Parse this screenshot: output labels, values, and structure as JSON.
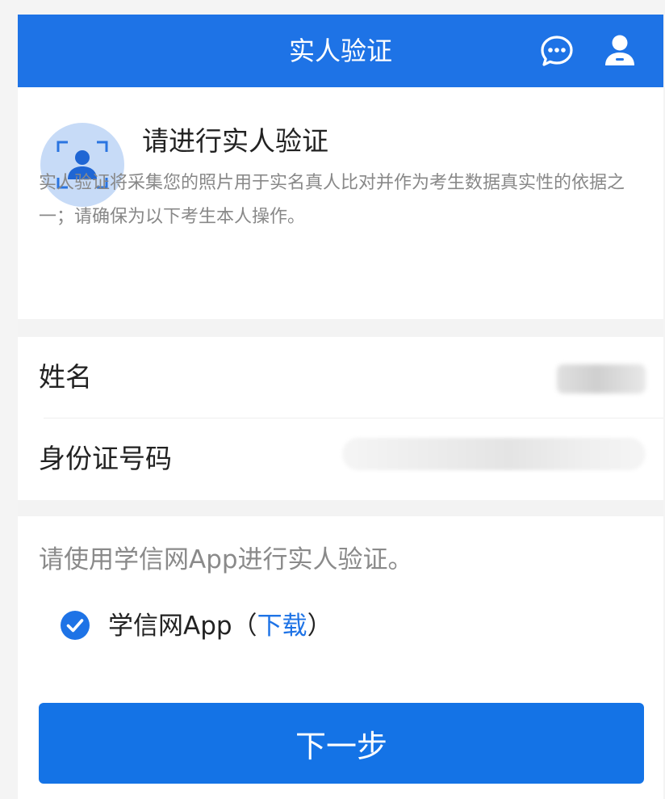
{
  "header": {
    "title": "实人验证",
    "chat_icon": "chat-bubble-icon",
    "user_icon": "user-icon"
  },
  "intro": {
    "icon": "face-scan-icon",
    "title": "请进行实人验证",
    "description": "实人验证将采集您的照片用于实名真人比对并作为考生数据真实性的依据之一；请确保为以下考生本人操作。"
  },
  "form": {
    "name_label": "姓名",
    "id_label": "身份证号码"
  },
  "method": {
    "hint": "请使用学信网App进行实人验证。",
    "option_label": "学信网App（",
    "option_link": "下载",
    "option_suffix": "）",
    "option_checked": true,
    "check_icon": "check-circle-icon"
  },
  "actions": {
    "next_label": "下一步"
  },
  "colors": {
    "brand": "#1e73e6",
    "avatar_bg": "#c7dbf7"
  }
}
